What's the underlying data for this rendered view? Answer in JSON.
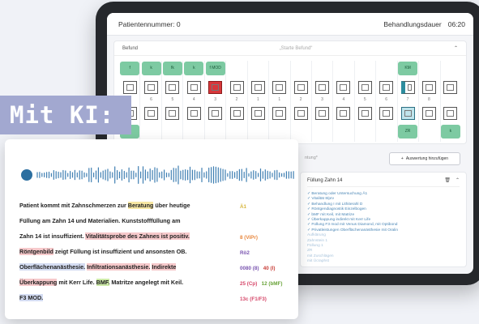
{
  "tablet": {
    "patient_label": "Patientennummer: 0",
    "duration_label": "Behandlungsdauer",
    "duration_value": "06:20",
    "befund_title": "Befund",
    "befund_placeholder": "„Starte Befund“",
    "upper_badges": [
      "f",
      "k",
      "fk",
      "k",
      "f\nMOD",
      "",
      "",
      "",
      "",
      "",
      "",
      "",
      "",
      "KM",
      "",
      ""
    ],
    "lower_badges": [
      "k",
      "",
      "",
      "",
      "",
      "",
      "",
      "",
      "",
      "",
      "",
      "",
      "",
      "ZR",
      "",
      "k"
    ],
    "tooth_numbers": [
      "7",
      "6",
      "5",
      "4",
      "3",
      "2",
      "1",
      "1",
      "2",
      "3",
      "4",
      "5",
      "6",
      "7",
      "8"
    ],
    "add_button": "Auswertung hinzufügen",
    "side_label": "ntung*",
    "list_title": "Füllung Zahn 14",
    "list_items": [
      "Beratung oder Untersuchung Ä1",
      "Vitalität 8/prv",
      "Behandlung I mit Lithiterahl D",
      "Röntgendiagnostik Einzelbogen",
      "bMF mit Keil, mit Matrize",
      "Überkappung indirekt mit Kerr Life",
      "Füllung F3 mod mit Venus Diamond, mit Optibond",
      "Privatleistungen Oberflächenanästhesie mit Oralin",
      "Aufklärung",
      "Zahnstein 1",
      "Füllung 1",
      "ZR",
      "mit Zuschlägen",
      "mit Ücraphst"
    ]
  },
  "card": {
    "transcript_lines": [
      [
        {
          "t": "Patient kommt mit Zahnschmerzen zur ",
          "h": ""
        },
        {
          "t": "Beratung",
          "h": "yellow"
        },
        {
          "t": " über heutige",
          "h": ""
        }
      ],
      [
        {
          "t": "Füllung am Zahn 14 und Materialien. Kunststofffüllung am",
          "h": ""
        }
      ],
      [
        {
          "t": "Zahn 14 ist insuffizient. ",
          "h": ""
        },
        {
          "t": "Vitalitätsprobe des Zahnes ist positiv.",
          "h": "pink"
        }
      ],
      [
        {
          "t": "Röntgenbild",
          "h": "pink"
        },
        {
          "t": " zeigt Füllung ist insuffizient und ansonsten OB.",
          "h": ""
        }
      ],
      [
        {
          "t": "Oberflächenanästhesie.",
          "h": "blue"
        },
        {
          "t": " ",
          "h": ""
        },
        {
          "t": "Infiltrationsanästhesie.",
          "h": "pink"
        },
        {
          "t": " ",
          "h": ""
        },
        {
          "t": "Indirekte",
          "h": "pink"
        }
      ],
      [
        {
          "t": "Überkappung",
          "h": "pink"
        },
        {
          "t": " mit Kerr Life. ",
          "h": ""
        },
        {
          "t": "BMF.",
          "h": "green"
        },
        {
          "t": " Matritze angelegt mit Keil.",
          "h": ""
        }
      ],
      [
        {
          "t": "F3 MOD.",
          "h": "blue"
        }
      ]
    ],
    "codes": [
      [
        {
          "t": "Ä1",
          "c": "yellow"
        }
      ],
      [],
      [
        {
          "t": "8 (ViPr)",
          "c": "orange"
        }
      ],
      [
        {
          "t": "Rö2",
          "c": "purple"
        }
      ],
      [
        {
          "t": "0080 (8)",
          "c": "purple"
        },
        {
          "t": "   40 (I)",
          "c": "red"
        }
      ],
      [
        {
          "t": "25 (Cp)",
          "c": "pink"
        },
        {
          "t": "   12 (bMF)",
          "c": "green"
        }
      ],
      [
        {
          "t": "13c (F1/F3)",
          "c": "pink"
        }
      ]
    ],
    "label": "Mit KI:"
  }
}
